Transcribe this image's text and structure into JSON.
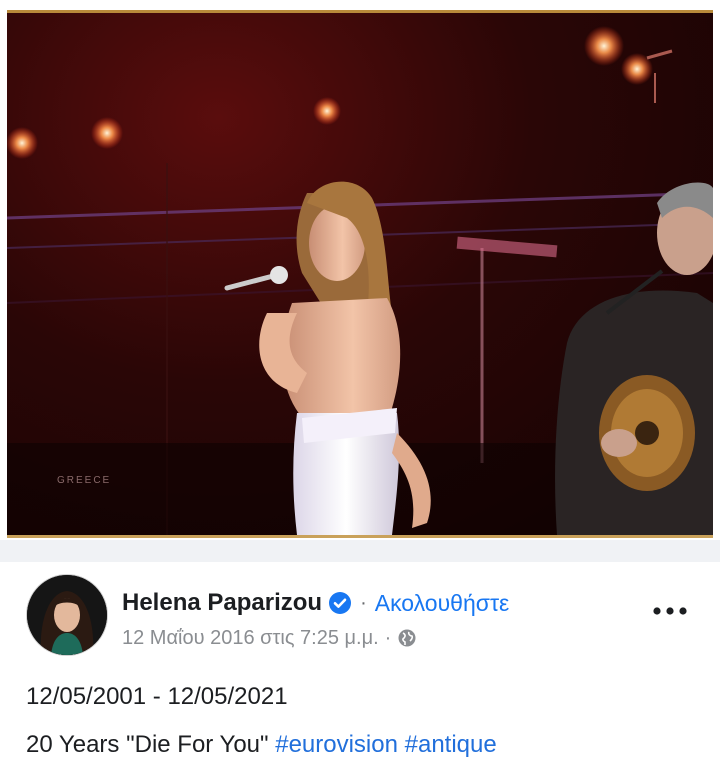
{
  "post": {
    "author": "Helena Paparizou",
    "verified_icon": "verified-badge-icon",
    "separator": "·",
    "follow_label": "Ακολουθήστε",
    "timestamp": "12 Μαΐου 2016 στις 7:25 μ.μ.",
    "meta_separator": "·",
    "audience_icon": "globe-icon",
    "more_icon": "more-options-icon",
    "text_line1": "12/05/2001 - 12/05/2021",
    "text_line2": "20 Years \"Die For You\"",
    "hashtags": [
      "#eurovision",
      "#antique"
    ]
  },
  "media": {
    "watermark": "GREECE"
  },
  "colors": {
    "link_blue": "#1877f2",
    "hashtag_blue": "#216fdb",
    "text_primary": "#1c1e21",
    "text_secondary": "#8a8d91",
    "divider_gray": "#f0f2f5"
  }
}
